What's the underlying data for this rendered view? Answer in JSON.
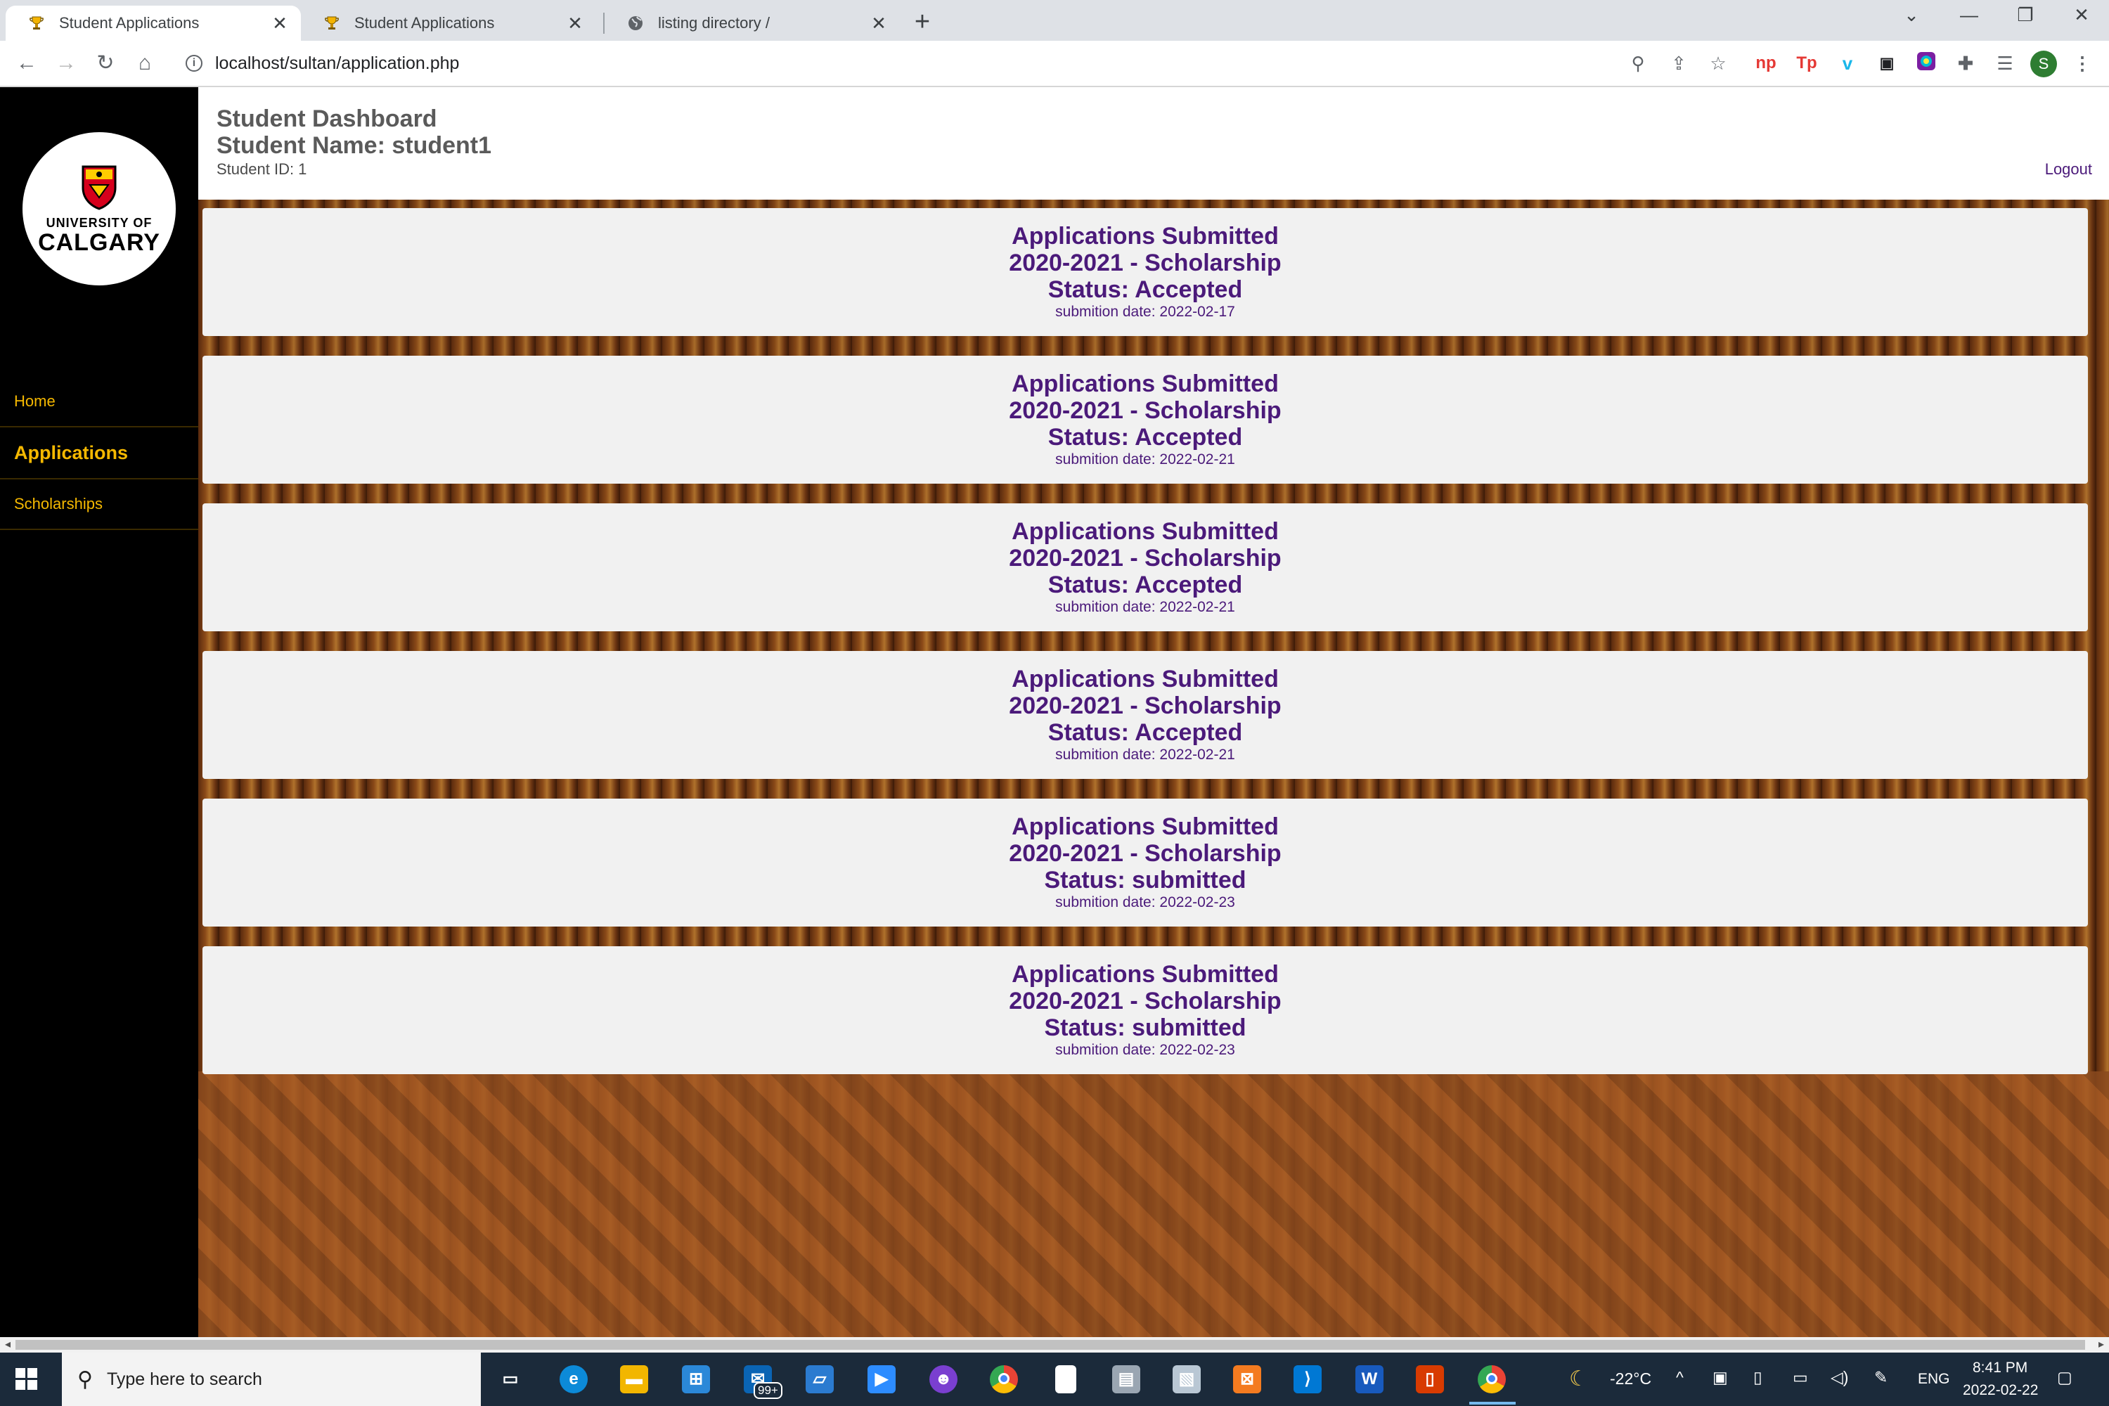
{
  "browser": {
    "tabs": [
      {
        "title": "Student Applications",
        "active": true,
        "icon": "trophy-icon"
      },
      {
        "title": "Student Applications",
        "active": false,
        "icon": "trophy-icon"
      },
      {
        "title": "listing directory /",
        "active": false,
        "icon": "globe-icon"
      }
    ],
    "close_glyph": "✕",
    "new_tab_glyph": "+",
    "url": "localhost/sultan/application.php",
    "profile_initial": "S"
  },
  "sidebar": {
    "logo": {
      "line1": "UNIVERSITY OF",
      "line2": "CALGARY"
    },
    "items": [
      {
        "label": "Home",
        "active": false
      },
      {
        "label": "Applications",
        "active": true
      },
      {
        "label": "Scholarships",
        "active": false
      }
    ]
  },
  "header": {
    "title": "Student Dashboard",
    "student_name": "Student Name: student1",
    "student_id": "Student ID: 1",
    "logout": "Logout"
  },
  "applications": [
    {
      "heading": "Applications Submitted",
      "scholarship": "2020-2021 - Scholarship",
      "status": "Status: Accepted",
      "date": "submition date: 2022-02-17"
    },
    {
      "heading": "Applications Submitted",
      "scholarship": "2020-2021 - Scholarship",
      "status": "Status: Accepted",
      "date": "submition date: 2022-02-21"
    },
    {
      "heading": "Applications Submitted",
      "scholarship": "2020-2021 - Scholarship",
      "status": "Status: Accepted",
      "date": "submition date: 2022-02-21"
    },
    {
      "heading": "Applications Submitted",
      "scholarship": "2020-2021 - Scholarship",
      "status": "Status: Accepted",
      "date": "submition date: 2022-02-21"
    },
    {
      "heading": "Applications Submitted",
      "scholarship": "2020-2021 - Scholarship",
      "status": "Status: submitted",
      "date": "submition date: 2022-02-23"
    },
    {
      "heading": "Applications Submitted",
      "scholarship": "2020-2021 - Scholarship",
      "status": "Status: submitted",
      "date": "submition date: 2022-02-23"
    }
  ],
  "colors": {
    "accent_purple": "#4b1a7a",
    "sidebar_gold": "#f5b800",
    "sidebar_bg": "#000000",
    "card_bg": "#f1f1f1"
  },
  "taskbar": {
    "search_placeholder": "Type here to search",
    "mail_badge": "99+",
    "weather": "-22°C",
    "language": "ENG",
    "time": "8:41 PM",
    "date": "2022-02-22"
  }
}
